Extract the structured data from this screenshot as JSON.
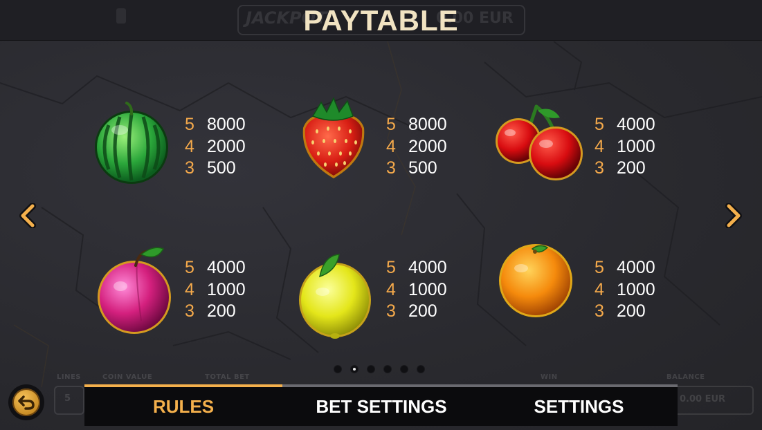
{
  "title": "PAYTABLE",
  "colors": {
    "accent": "#f4b04c",
    "count": "#f4a94b",
    "value": "#ffffff",
    "title": "#f1e3c2"
  },
  "header_bg": {
    "jackpot": "JACKPOT",
    "jackpot_value": "0.00 EUR"
  },
  "bottom_bg": {
    "lines_label": "LINES",
    "lines_value": "5",
    "coin_value_label": "COIN VALUE",
    "total_bet_label": "TOTAL BET",
    "win_label": "WIN",
    "balance_label": "BALANCE",
    "balance_value": "0.00 EUR"
  },
  "symbols": [
    {
      "icon": "watermelon-icon",
      "pays": [
        {
          "count": "5",
          "value": "8000"
        },
        {
          "count": "4",
          "value": "2000"
        },
        {
          "count": "3",
          "value": "500"
        }
      ]
    },
    {
      "icon": "strawberry-icon",
      "pays": [
        {
          "count": "5",
          "value": "8000"
        },
        {
          "count": "4",
          "value": "2000"
        },
        {
          "count": "3",
          "value": "500"
        }
      ]
    },
    {
      "icon": "cherries-icon",
      "pays": [
        {
          "count": "5",
          "value": "4000"
        },
        {
          "count": "4",
          "value": "1000"
        },
        {
          "count": "3",
          "value": "200"
        }
      ]
    },
    {
      "icon": "plum-icon",
      "pays": [
        {
          "count": "5",
          "value": "4000"
        },
        {
          "count": "4",
          "value": "1000"
        },
        {
          "count": "3",
          "value": "200"
        }
      ]
    },
    {
      "icon": "lemon-icon",
      "pays": [
        {
          "count": "5",
          "value": "4000"
        },
        {
          "count": "4",
          "value": "1000"
        },
        {
          "count": "3",
          "value": "200"
        }
      ]
    },
    {
      "icon": "orange-icon",
      "pays": [
        {
          "count": "5",
          "value": "4000"
        },
        {
          "count": "4",
          "value": "1000"
        },
        {
          "count": "3",
          "value": "200"
        }
      ]
    }
  ],
  "pagination": {
    "total": 6,
    "active": 2
  },
  "tabs": [
    {
      "label": "RULES",
      "active": true
    },
    {
      "label": "BET SETTINGS",
      "active": false
    },
    {
      "label": "SETTINGS",
      "active": false
    }
  ]
}
